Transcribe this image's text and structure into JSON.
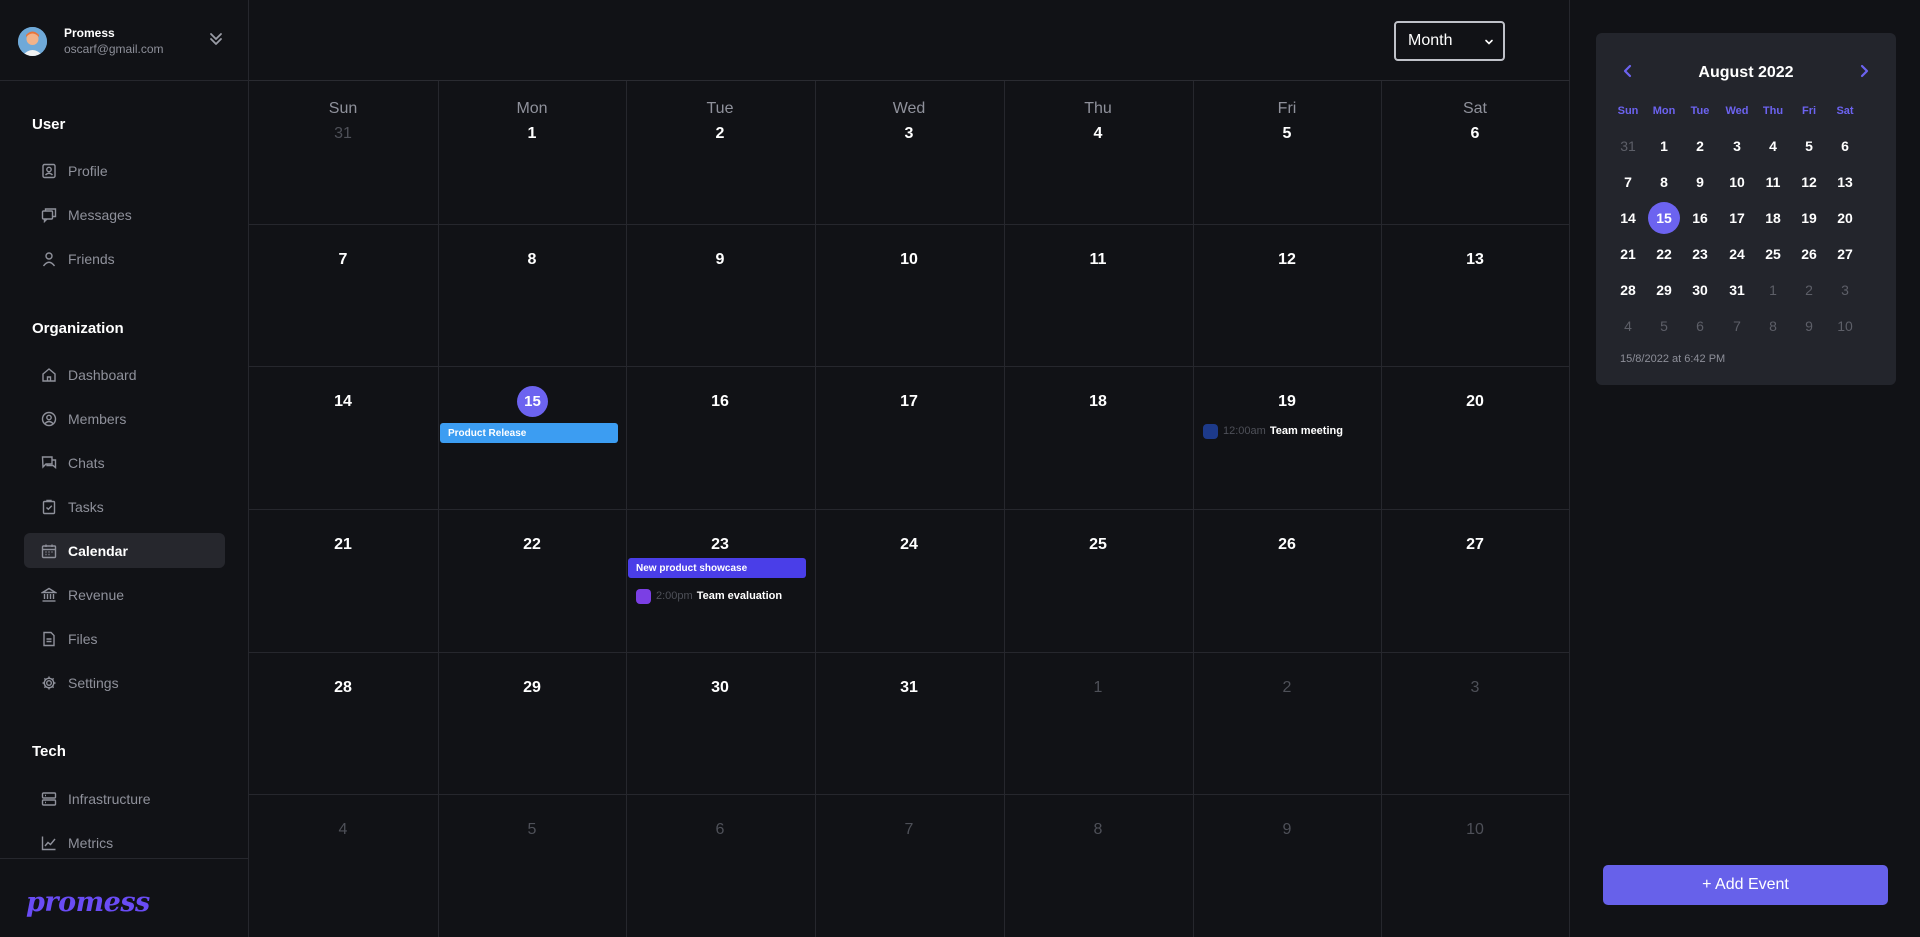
{
  "user": {
    "name": "Promess",
    "email": "oscarf@gmail.com"
  },
  "sidebar": {
    "sections": [
      {
        "title": "User",
        "items": [
          {
            "label": "Profile",
            "icon": "profile-icon"
          },
          {
            "label": "Messages",
            "icon": "messages-icon"
          },
          {
            "label": "Friends",
            "icon": "friends-icon"
          }
        ]
      },
      {
        "title": "Organization",
        "items": [
          {
            "label": "Dashboard",
            "icon": "home-icon"
          },
          {
            "label": "Members",
            "icon": "members-icon"
          },
          {
            "label": "Chats",
            "icon": "chats-icon"
          },
          {
            "label": "Tasks",
            "icon": "tasks-icon"
          },
          {
            "label": "Calendar",
            "icon": "calendar-icon",
            "active": true
          },
          {
            "label": "Revenue",
            "icon": "bank-icon"
          },
          {
            "label": "Files",
            "icon": "file-icon"
          },
          {
            "label": "Settings",
            "icon": "gear-icon"
          }
        ]
      },
      {
        "title": "Tech",
        "items": [
          {
            "label": "Infrastructure",
            "icon": "server-icon"
          },
          {
            "label": "Metrics",
            "icon": "chart-line-icon"
          }
        ]
      }
    ],
    "brand": "promess"
  },
  "toolbar": {
    "view_select_value": "Month"
  },
  "calendar": {
    "weekdays": [
      "Sun",
      "Mon",
      "Tue",
      "Wed",
      "Thu",
      "Fri",
      "Sat"
    ],
    "weeks": [
      [
        {
          "d": "31",
          "m": true
        },
        {
          "d": "1"
        },
        {
          "d": "2"
        },
        {
          "d": "3"
        },
        {
          "d": "4"
        },
        {
          "d": "5"
        },
        {
          "d": "6"
        }
      ],
      [
        {
          "d": "7"
        },
        {
          "d": "8"
        },
        {
          "d": "9"
        },
        {
          "d": "10"
        },
        {
          "d": "11"
        },
        {
          "d": "12"
        },
        {
          "d": "13"
        }
      ],
      [
        {
          "d": "14"
        },
        {
          "d": "15",
          "today": true
        },
        {
          "d": "16"
        },
        {
          "d": "17"
        },
        {
          "d": "18"
        },
        {
          "d": "19"
        },
        {
          "d": "20"
        }
      ],
      [
        {
          "d": "21"
        },
        {
          "d": "22"
        },
        {
          "d": "23"
        },
        {
          "d": "24"
        },
        {
          "d": "25"
        },
        {
          "d": "26"
        },
        {
          "d": "27"
        }
      ],
      [
        {
          "d": "28"
        },
        {
          "d": "29"
        },
        {
          "d": "30"
        },
        {
          "d": "31"
        },
        {
          "d": "1",
          "m": true
        },
        {
          "d": "2",
          "m": true
        },
        {
          "d": "3",
          "m": true
        }
      ],
      [
        {
          "d": "4",
          "m": true
        },
        {
          "d": "5",
          "m": true
        },
        {
          "d": "6",
          "m": true
        },
        {
          "d": "7",
          "m": true
        },
        {
          "d": "8",
          "m": true
        },
        {
          "d": "9",
          "m": true
        },
        {
          "d": "10",
          "m": true
        }
      ]
    ],
    "events": {
      "product_release": {
        "title": "Product Release",
        "color": "#3c9df2"
      },
      "team_meeting": {
        "time": "12:00am",
        "title": "Team meeting",
        "color": "#1d3a8a"
      },
      "product_showcase": {
        "title": "New product showcase",
        "color": "#4a3ee8"
      },
      "team_evaluation": {
        "time": "2:00pm",
        "title": "Team evaluation",
        "color": "#7b3fe4"
      }
    }
  },
  "mini_calendar": {
    "title": "August 2022",
    "weekdays": [
      "Sun",
      "Mon",
      "Tue",
      "Wed",
      "Thu",
      "Fri",
      "Sat"
    ],
    "weeks": [
      [
        {
          "d": "31",
          "m": true
        },
        {
          "d": "1"
        },
        {
          "d": "2"
        },
        {
          "d": "3"
        },
        {
          "d": "4"
        },
        {
          "d": "5"
        },
        {
          "d": "6"
        }
      ],
      [
        {
          "d": "7"
        },
        {
          "d": "8"
        },
        {
          "d": "9"
        },
        {
          "d": "10"
        },
        {
          "d": "11"
        },
        {
          "d": "12"
        },
        {
          "d": "13"
        }
      ],
      [
        {
          "d": "14"
        },
        {
          "d": "15",
          "selected": true
        },
        {
          "d": "16"
        },
        {
          "d": "17"
        },
        {
          "d": "18"
        },
        {
          "d": "19"
        },
        {
          "d": "20"
        }
      ],
      [
        {
          "d": "21"
        },
        {
          "d": "22"
        },
        {
          "d": "23"
        },
        {
          "d": "24"
        },
        {
          "d": "25"
        },
        {
          "d": "26"
        },
        {
          "d": "27"
        }
      ],
      [
        {
          "d": "28"
        },
        {
          "d": "29"
        },
        {
          "d": "30"
        },
        {
          "d": "31"
        },
        {
          "d": "1",
          "m": true
        },
        {
          "d": "2",
          "m": true
        },
        {
          "d": "3",
          "m": true
        }
      ],
      [
        {
          "d": "4",
          "m": true
        },
        {
          "d": "5",
          "m": true
        },
        {
          "d": "6",
          "m": true
        },
        {
          "d": "7",
          "m": true
        },
        {
          "d": "8",
          "m": true
        },
        {
          "d": "9",
          "m": true
        },
        {
          "d": "10",
          "m": true
        }
      ]
    ],
    "datetime": "15/8/2022 at 6:42 PM"
  },
  "add_event_label": "+ Add Event",
  "colors": {
    "accent": "#6c63f0",
    "background": "#111216",
    "panel": "#23252c"
  }
}
